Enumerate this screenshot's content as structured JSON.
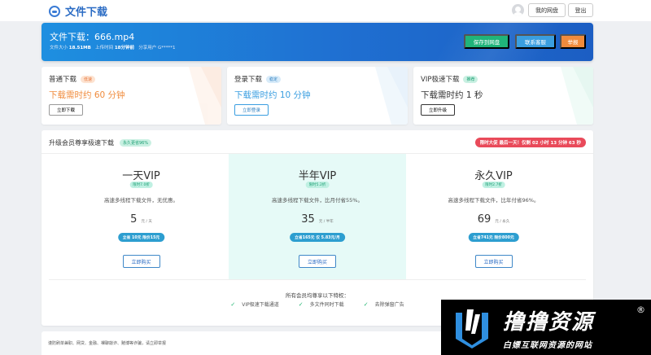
{
  "header": {
    "title": "文件下载",
    "my_disk_label": "我的网盘",
    "logout_label": "登出"
  },
  "banner": {
    "title": "文件下载：666.mp4",
    "size_label": "文件大小",
    "size_value": "18.51MB",
    "upload_label": "上传时间",
    "upload_value": "18分钟前",
    "share_label": "分享用户",
    "share_value": "G*****1",
    "save_label": "保存到网盘",
    "contact_label": "联系客服",
    "report_label": "举报",
    "colors": {
      "save": "#20b47a",
      "contact": "#3a9ee0",
      "report": "#f08b3c"
    }
  },
  "speeds": [
    {
      "title": "普通下载",
      "tag": "低速",
      "speed": "下载需时约 60 分钟",
      "button": "立即下载",
      "color": "#f08b3c",
      "tag_bg": "#fde3d1",
      "tag_fg": "#e7743a"
    },
    {
      "title": "登录下载",
      "tag": "稳定",
      "speed": "下载需时约 10 分钟",
      "button": "立即登录",
      "color": "#3a9ee0",
      "tag_bg": "#d8ebf9",
      "tag_fg": "#2d7fc0"
    },
    {
      "title": "VIP极速下载",
      "tag": "推荐",
      "speed": "下载需时约 1 秒",
      "button": "立即升级",
      "color": "#333333",
      "tag_bg": "#c9f0e2",
      "tag_fg": "#1d9f74"
    }
  ],
  "vip": {
    "title": "升级会员尊享极速下载",
    "tag": "永久更省96%",
    "countdown": "限时大促 最后一天！仅剩 02 小时 13 分钟 63 秒",
    "plans": [
      {
        "name": "一天VIP",
        "discount": "限时7.0折",
        "desc": "高速多线程下载文件，无优惠。",
        "price": "5",
        "unit": "元 / 天",
        "save": "立省 10元 限价15元",
        "buy": "立即购买"
      },
      {
        "name": "半年VIP",
        "discount": "限时5.2折",
        "desc": "高速多线程下载文件，比月付省55%。",
        "price": "35",
        "unit": "元 / 半年",
        "save": "立省165元 仅 5.83元/月",
        "buy": "立即购买"
      },
      {
        "name": "永久VIP",
        "discount": "限时2.7折",
        "desc": "高速多线程下载文件，比年付省96%。",
        "price": "69",
        "unit": "元 / 永久",
        "save": "立省741元 限价800元",
        "buy": "立即购买"
      }
    ],
    "privileges_title": "所有会员均尊享以下特权：",
    "privileges": [
      "VIP极速下载通道",
      "多文件同时下载",
      "去除弹窗广告"
    ]
  },
  "footer": {
    "text": "谨防刷单兼职、网贷、金融、裸聊敲诈、赌博等诈骗，请立即举报"
  },
  "watermark": {
    "title": "撸撸资源",
    "registered": "®",
    "subtitle": "白嫖互联网资源的网站"
  }
}
